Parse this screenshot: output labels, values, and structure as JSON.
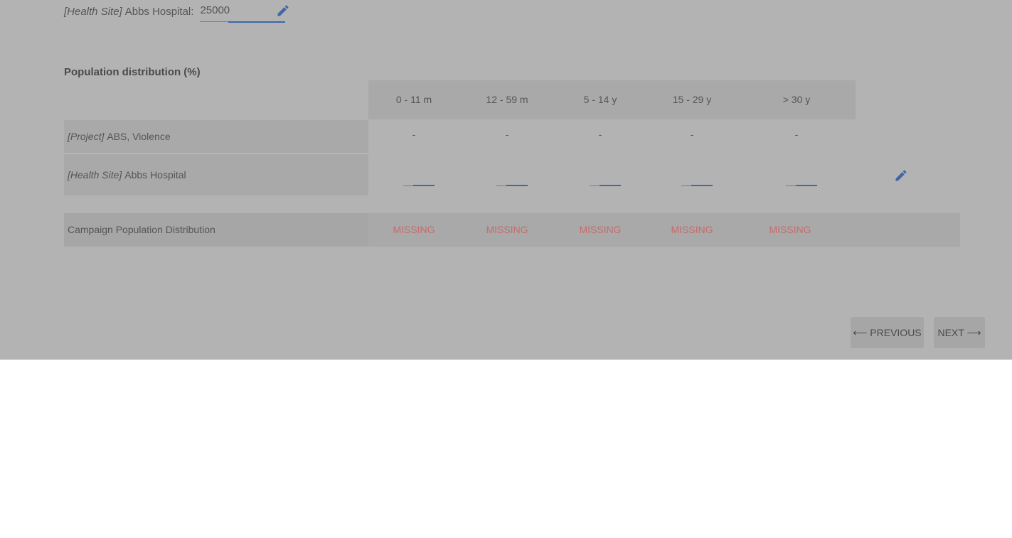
{
  "total_population": {
    "tag": "[Health Site]",
    "name": "Abbs Hospital:",
    "value": "25000",
    "edit_icon": "pencil-icon"
  },
  "distribution": {
    "title": "Population distribution (%)",
    "columns": [
      "0 - 11 m",
      "12 - 59 m",
      "5 - 14 y",
      "15 - 29 y",
      "> 30 y"
    ],
    "rows": [
      {
        "tag": "[Project]",
        "name": "ABS, Violence",
        "values": [
          "-",
          "-",
          "-",
          "-",
          "-"
        ]
      },
      {
        "tag": "[Health Site]",
        "name": "Abbs Hospital",
        "values": [
          "",
          "",
          "",
          "",
          ""
        ]
      }
    ],
    "edit_icon": "pencil-icon",
    "campaign": {
      "label": "Campaign Population Distribution",
      "values": [
        "MISSING",
        "MISSING",
        "MISSING",
        "MISSING",
        "MISSING"
      ]
    }
  },
  "navigation": {
    "prev_arrow": "⟵",
    "prev_label": "PREVIOUS",
    "next_label": "NEXT",
    "next_arrow": "⟶"
  },
  "colors": {
    "overlay": "#b3b3b3",
    "accent": "#3f66a8",
    "missing": "#c86a6a"
  }
}
